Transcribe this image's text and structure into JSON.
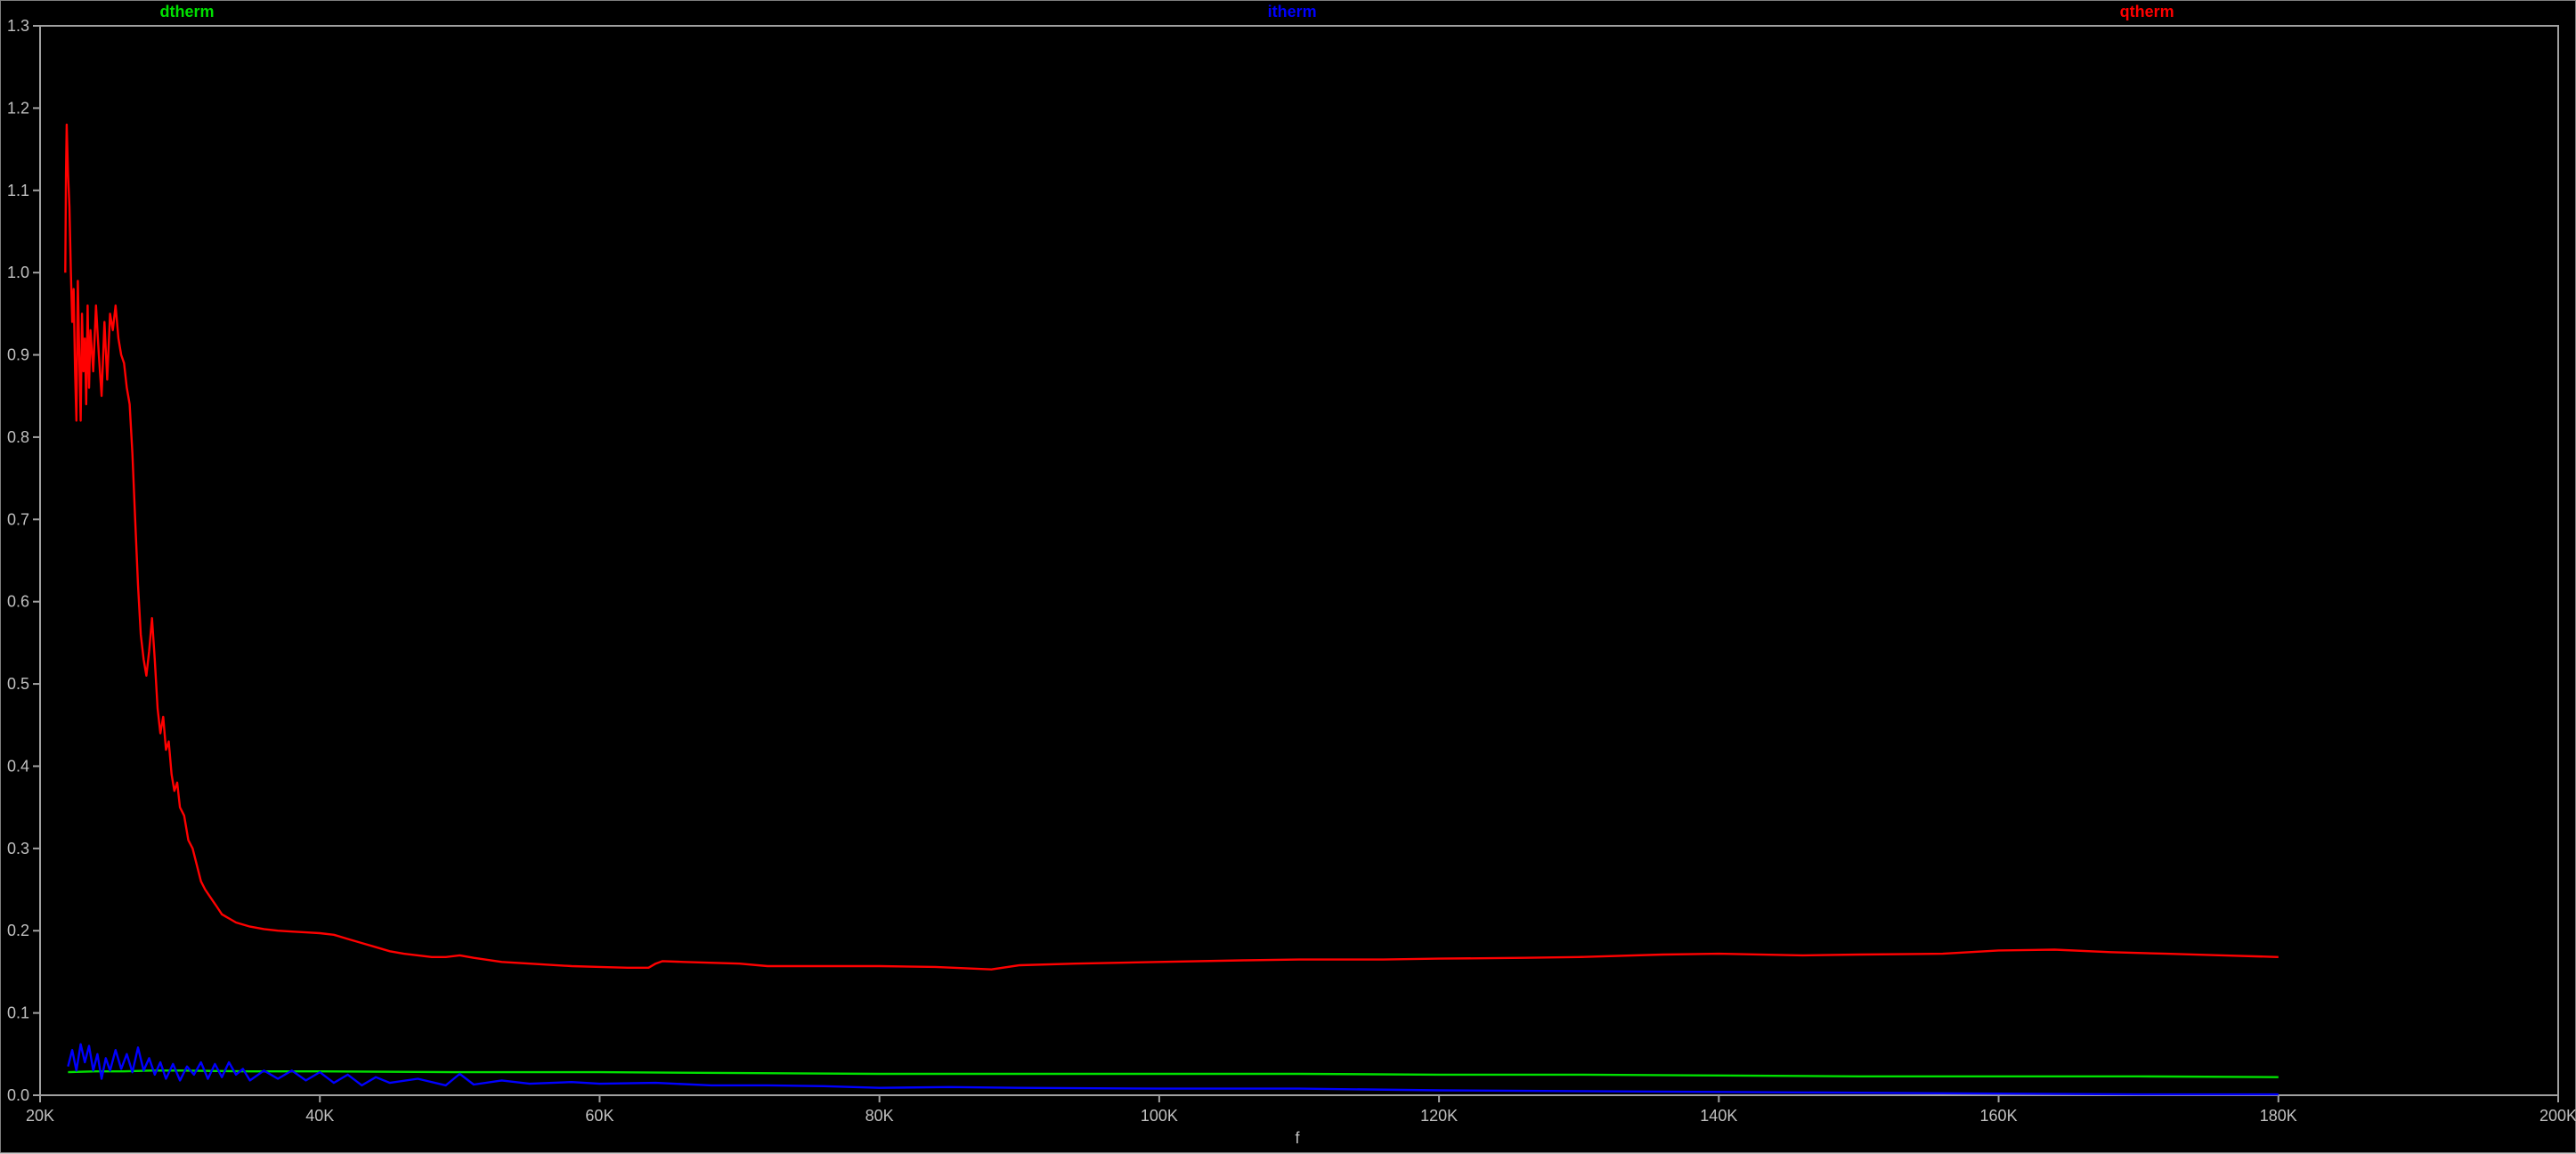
{
  "colors": {
    "background": "#000000",
    "axis": "#a0a0a0",
    "tick_text": "#c0c0c0"
  },
  "chart_data": {
    "type": "line",
    "xlabel": "f",
    "ylabel": "",
    "title": "",
    "xlim": [
      20000,
      200000
    ],
    "ylim": [
      0,
      1.3
    ],
    "grid": false,
    "legend_placement": "top",
    "x_ticks": [
      {
        "value": 20000,
        "label": "20K"
      },
      {
        "value": 40000,
        "label": "40K"
      },
      {
        "value": 60000,
        "label": "60K"
      },
      {
        "value": 80000,
        "label": "80K"
      },
      {
        "value": 100000,
        "label": "100K"
      },
      {
        "value": 120000,
        "label": "120K"
      },
      {
        "value": 140000,
        "label": "140K"
      },
      {
        "value": 160000,
        "label": "160K"
      },
      {
        "value": 180000,
        "label": "180K"
      },
      {
        "value": 200000,
        "label": "200K"
      }
    ],
    "y_ticks": [
      {
        "value": 0.0,
        "label": "0.0"
      },
      {
        "value": 0.1,
        "label": "0.1"
      },
      {
        "value": 0.2,
        "label": "0.2"
      },
      {
        "value": 0.3,
        "label": "0.3"
      },
      {
        "value": 0.4,
        "label": "0.4"
      },
      {
        "value": 0.5,
        "label": "0.5"
      },
      {
        "value": 0.6,
        "label": "0.6"
      },
      {
        "value": 0.7,
        "label": "0.7"
      },
      {
        "value": 0.8,
        "label": "0.8"
      },
      {
        "value": 0.9,
        "label": "0.9"
      },
      {
        "value": 1.0,
        "label": "1.0"
      },
      {
        "value": 1.1,
        "label": "1.1"
      },
      {
        "value": 1.2,
        "label": "1.2"
      },
      {
        "value": 1.3,
        "label": "1.3"
      }
    ],
    "series": [
      {
        "name": "dtherm",
        "color": "#00e000",
        "legend_x": 30500,
        "points": [
          [
            22000,
            0.028
          ],
          [
            24000,
            0.029
          ],
          [
            26000,
            0.029
          ],
          [
            28000,
            0.03
          ],
          [
            30000,
            0.03
          ],
          [
            35000,
            0.029
          ],
          [
            40000,
            0.029
          ],
          [
            50000,
            0.028
          ],
          [
            60000,
            0.028
          ],
          [
            70000,
            0.027
          ],
          [
            80000,
            0.026
          ],
          [
            90000,
            0.026
          ],
          [
            100000,
            0.026
          ],
          [
            110000,
            0.026
          ],
          [
            120000,
            0.025
          ],
          [
            130000,
            0.025
          ],
          [
            140000,
            0.024
          ],
          [
            150000,
            0.023
          ],
          [
            160000,
            0.023
          ],
          [
            170000,
            0.023
          ],
          [
            180000,
            0.022
          ]
        ]
      },
      {
        "name": "itherm",
        "color": "#0000ff",
        "legend_x": 109500,
        "points": [
          [
            22000,
            0.035
          ],
          [
            22300,
            0.055
          ],
          [
            22600,
            0.03
          ],
          [
            22900,
            0.062
          ],
          [
            23200,
            0.04
          ],
          [
            23500,
            0.06
          ],
          [
            23800,
            0.03
          ],
          [
            24100,
            0.05
          ],
          [
            24400,
            0.02
          ],
          [
            24700,
            0.045
          ],
          [
            25000,
            0.03
          ],
          [
            25400,
            0.055
          ],
          [
            25800,
            0.032
          ],
          [
            26200,
            0.05
          ],
          [
            26600,
            0.028
          ],
          [
            27000,
            0.058
          ],
          [
            27400,
            0.03
          ],
          [
            27800,
            0.045
          ],
          [
            28200,
            0.025
          ],
          [
            28600,
            0.04
          ],
          [
            29000,
            0.02
          ],
          [
            29500,
            0.038
          ],
          [
            30000,
            0.018
          ],
          [
            30500,
            0.035
          ],
          [
            31000,
            0.025
          ],
          [
            31500,
            0.04
          ],
          [
            32000,
            0.02
          ],
          [
            32500,
            0.038
          ],
          [
            33000,
            0.022
          ],
          [
            33500,
            0.04
          ],
          [
            34000,
            0.025
          ],
          [
            34500,
            0.032
          ],
          [
            35000,
            0.018
          ],
          [
            36000,
            0.03
          ],
          [
            37000,
            0.02
          ],
          [
            38000,
            0.03
          ],
          [
            39000,
            0.018
          ],
          [
            40000,
            0.028
          ],
          [
            41000,
            0.015
          ],
          [
            42000,
            0.025
          ],
          [
            43000,
            0.012
          ],
          [
            44000,
            0.022
          ],
          [
            45000,
            0.015
          ],
          [
            47000,
            0.02
          ],
          [
            49000,
            0.012
          ],
          [
            50000,
            0.026
          ],
          [
            51000,
            0.013
          ],
          [
            53000,
            0.018
          ],
          [
            55000,
            0.014
          ],
          [
            58000,
            0.016
          ],
          [
            60000,
            0.014
          ],
          [
            64000,
            0.015
          ],
          [
            68000,
            0.012
          ],
          [
            72000,
            0.012
          ],
          [
            76000,
            0.011
          ],
          [
            80000,
            0.009
          ],
          [
            85000,
            0.01
          ],
          [
            90000,
            0.009
          ],
          [
            100000,
            0.008
          ],
          [
            110000,
            0.008
          ],
          [
            120000,
            0.006
          ],
          [
            130000,
            0.005
          ],
          [
            140000,
            0.004
          ],
          [
            150000,
            0.003
          ],
          [
            160000,
            0.002
          ],
          [
            170000,
            0.001
          ],
          [
            180000,
            0.001
          ]
        ]
      },
      {
        "name": "qtherm",
        "color": "#ff0000",
        "legend_x": 170600,
        "points": [
          [
            21800,
            1.0
          ],
          [
            21850,
            1.12
          ],
          [
            21900,
            1.18
          ],
          [
            22000,
            1.12
          ],
          [
            22100,
            1.08
          ],
          [
            22200,
            1.0
          ],
          [
            22300,
            0.94
          ],
          [
            22400,
            0.98
          ],
          [
            22500,
            0.88
          ],
          [
            22600,
            0.82
          ],
          [
            22700,
            0.99
          ],
          [
            22800,
            0.9
          ],
          [
            22900,
            0.82
          ],
          [
            23000,
            0.95
          ],
          [
            23100,
            0.88
          ],
          [
            23200,
            0.92
          ],
          [
            23300,
            0.84
          ],
          [
            23400,
            0.96
          ],
          [
            23500,
            0.86
          ],
          [
            23600,
            0.93
          ],
          [
            23800,
            0.88
          ],
          [
            24000,
            0.96
          ],
          [
            24200,
            0.9
          ],
          [
            24400,
            0.85
          ],
          [
            24600,
            0.94
          ],
          [
            24800,
            0.87
          ],
          [
            25000,
            0.95
          ],
          [
            25200,
            0.93
          ],
          [
            25400,
            0.96
          ],
          [
            25600,
            0.92
          ],
          [
            25800,
            0.9
          ],
          [
            26000,
            0.89
          ],
          [
            26200,
            0.86
          ],
          [
            26400,
            0.84
          ],
          [
            26600,
            0.78
          ],
          [
            26800,
            0.7
          ],
          [
            27000,
            0.62
          ],
          [
            27200,
            0.56
          ],
          [
            27400,
            0.53
          ],
          [
            27600,
            0.51
          ],
          [
            27800,
            0.54
          ],
          [
            28000,
            0.58
          ],
          [
            28200,
            0.53
          ],
          [
            28400,
            0.47
          ],
          [
            28600,
            0.44
          ],
          [
            28800,
            0.46
          ],
          [
            29000,
            0.42
          ],
          [
            29200,
            0.43
          ],
          [
            29400,
            0.39
          ],
          [
            29600,
            0.37
          ],
          [
            29800,
            0.38
          ],
          [
            30000,
            0.35
          ],
          [
            30300,
            0.34
          ],
          [
            30600,
            0.31
          ],
          [
            30900,
            0.3
          ],
          [
            31200,
            0.28
          ],
          [
            31500,
            0.26
          ],
          [
            31800,
            0.25
          ],
          [
            32200,
            0.24
          ],
          [
            32600,
            0.23
          ],
          [
            33000,
            0.22
          ],
          [
            33500,
            0.215
          ],
          [
            34000,
            0.21
          ],
          [
            35000,
            0.205
          ],
          [
            36000,
            0.202
          ],
          [
            37000,
            0.2
          ],
          [
            38000,
            0.199
          ],
          [
            39000,
            0.198
          ],
          [
            40000,
            0.197
          ],
          [
            41000,
            0.195
          ],
          [
            42000,
            0.19
          ],
          [
            43000,
            0.185
          ],
          [
            44000,
            0.18
          ],
          [
            45000,
            0.175
          ],
          [
            46000,
            0.172
          ],
          [
            48000,
            0.168
          ],
          [
            49000,
            0.168
          ],
          [
            50000,
            0.17
          ],
          [
            51000,
            0.167
          ],
          [
            53000,
            0.162
          ],
          [
            55000,
            0.16
          ],
          [
            58000,
            0.157
          ],
          [
            60000,
            0.156
          ],
          [
            62000,
            0.155
          ],
          [
            63500,
            0.155
          ],
          [
            64000,
            0.16
          ],
          [
            64500,
            0.163
          ],
          [
            66000,
            0.162
          ],
          [
            70000,
            0.16
          ],
          [
            72000,
            0.157
          ],
          [
            76000,
            0.157
          ],
          [
            80000,
            0.157
          ],
          [
            84000,
            0.156
          ],
          [
            88000,
            0.153
          ],
          [
            90000,
            0.158
          ],
          [
            94000,
            0.16
          ],
          [
            100000,
            0.162
          ],
          [
            106000,
            0.164
          ],
          [
            110000,
            0.165
          ],
          [
            116000,
            0.165
          ],
          [
            120000,
            0.166
          ],
          [
            126000,
            0.167
          ],
          [
            130000,
            0.168
          ],
          [
            136000,
            0.171
          ],
          [
            140000,
            0.172
          ],
          [
            146000,
            0.17
          ],
          [
            150000,
            0.171
          ],
          [
            156000,
            0.172
          ],
          [
            160000,
            0.176
          ],
          [
            164000,
            0.177
          ],
          [
            168000,
            0.174
          ],
          [
            172000,
            0.172
          ],
          [
            176000,
            0.17
          ],
          [
            180000,
            0.168
          ]
        ]
      }
    ]
  }
}
